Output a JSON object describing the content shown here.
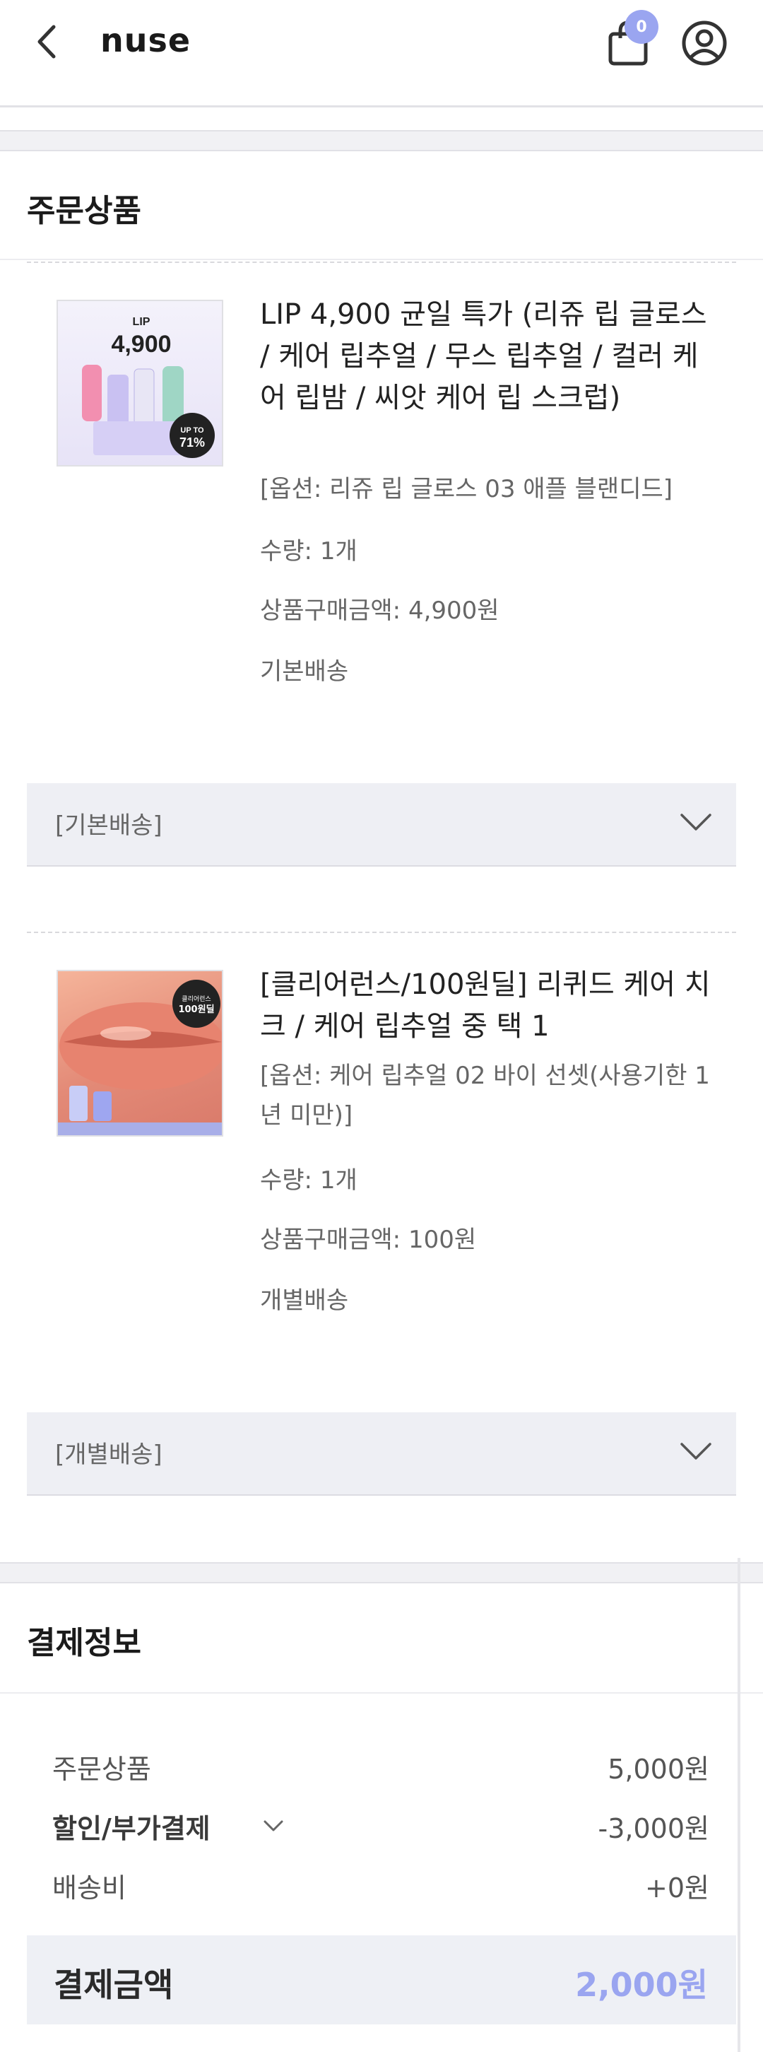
{
  "header": {
    "logo": "nuse",
    "cart_count": "0"
  },
  "order_section": {
    "title": "주문상품",
    "items": [
      {
        "thumb_text": [
          "LIP",
          "4,900",
          "UP TO 71%"
        ],
        "name": "LIP 4,900 균일 특가 (리쥬 립 글로스 / 케어 립추얼 / 무스 립추얼 / 컬러 케어 립밤 / 씨앗 케어 립 스크럽)",
        "option": "[옵션: 리쥬 립 글로스 03 애플 블랜디드]",
        "quantity": "수량: 1개",
        "price": "상품구매금액: 4,900원",
        "shipping_type": "기본배송",
        "shipping_group_label": "[기본배송]"
      },
      {
        "thumb_text": [
          "클리어런스",
          "100원딜"
        ],
        "name": "[클리어런스/100원딜] 리퀴드 케어 치크 / 케어 립추얼 중 택 1",
        "option": "[옵션: 케어 립추얼 02 바이 선셋(사용기한 1년 미만)]",
        "quantity": "수량: 1개",
        "price": "상품구매금액: 100원",
        "shipping_type": "개별배송",
        "shipping_group_label": "[개별배송]"
      }
    ]
  },
  "payment_section": {
    "title": "결제정보",
    "rows": [
      {
        "label": "주문상품",
        "value": "5,000원"
      },
      {
        "label": "할인/부가결제",
        "value": "-3,000원"
      },
      {
        "label": "배송비",
        "value": "+0원"
      }
    ],
    "total_label": "결제금액",
    "total_value": "2,000원"
  },
  "colors": {
    "accent": "#9aa5f0",
    "section_bg": "#f1f1f4",
    "bar_bg": "#eeeff4"
  },
  "icons": [
    "back-icon",
    "cart-icon",
    "user-icon",
    "chevron-down-icon"
  ]
}
